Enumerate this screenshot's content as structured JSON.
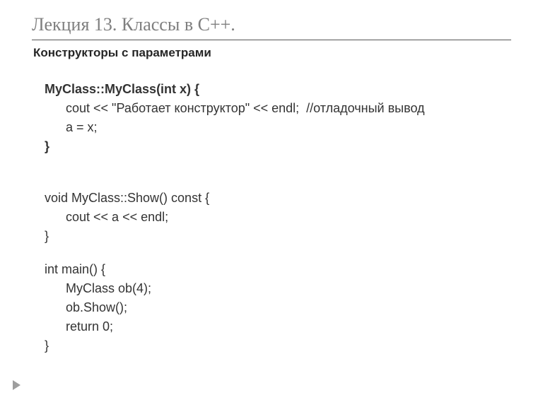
{
  "title": "Лекция 13. Классы в С++.",
  "subtitle": "Конструкторы с параметрами",
  "code": {
    "b1_l1": "MyClass::MyClass(int x) {",
    "b1_l2": "      cout << \"Работает конструктор\" << endl;  //отладочный вывод",
    "b1_l3": "      a = x;",
    "b1_l4": "}",
    "b2_l1": "void MyClass::Show() const {",
    "b2_l2": "      cout << a << endl;",
    "b2_l3": "}",
    "b3_l1": "int main() {",
    "b3_l2": "      MyClass ob(4);",
    "b3_l3": "      ob.Show();",
    "b3_l4": "      return 0;",
    "b3_l5": "}"
  }
}
